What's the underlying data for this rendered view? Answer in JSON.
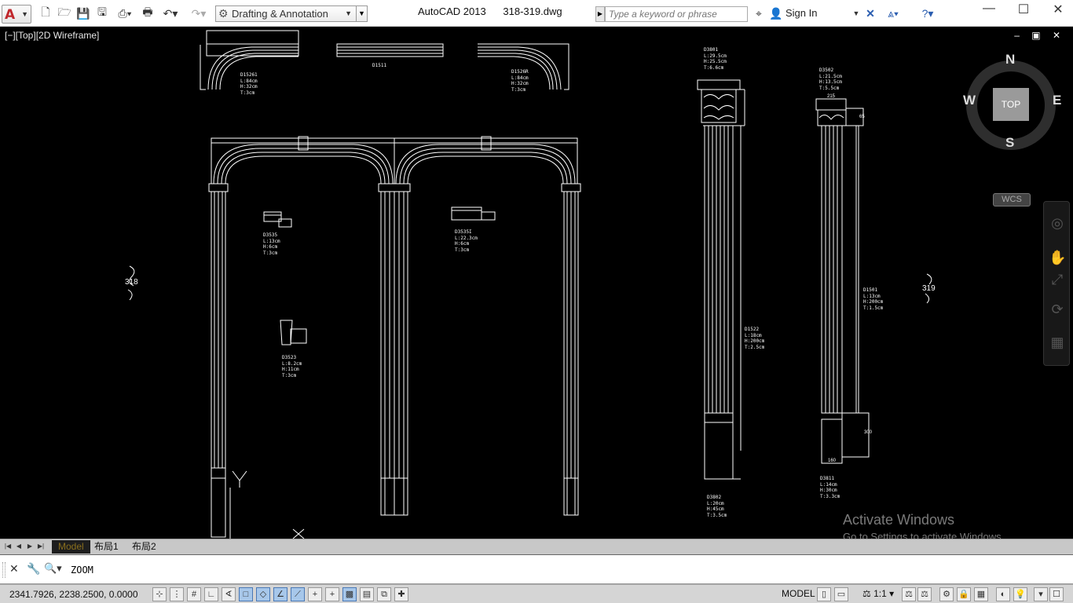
{
  "title_bar": {
    "workspace": "Drafting & Annotation",
    "app_name": "AutoCAD 2013",
    "file_name": "318-319.dwg",
    "search_placeholder": "Type a keyword or phrase",
    "sign_in": "Sign In"
  },
  "viewport": {
    "label": "[−][Top][2D Wireframe]",
    "controls": "– ▣ ✕"
  },
  "viewcube": {
    "north": "N",
    "south": "S",
    "east": "E",
    "west": "W",
    "top": "TOP",
    "ucs": "WCS"
  },
  "drawing": {
    "break_left": "318",
    "break_right": "319",
    "labels": {
      "d1": [
        "D15261",
        "L:84cm",
        "H:32cm",
        "T:3cm"
      ],
      "d2": [
        "D1511"
      ],
      "d3": [
        "D1526R",
        "L:84cm",
        "H:32cm",
        "T:3cm"
      ],
      "d4": [
        "D3535",
        "L:13cm",
        "H:6cm",
        "T:3cm"
      ],
      "d5": [
        "D3535I",
        "L:22.3cm",
        "H:6cm",
        "T:3cm"
      ],
      "d6": [
        "D3523",
        "L:8.2cm",
        "H:11cm",
        "T:3cm"
      ],
      "d7": [
        "D3801",
        "L:29.5cm",
        "H:25.5cm",
        "T:6.6cm"
      ],
      "d8": [
        "D1522",
        "L:18cm",
        "H:200cm",
        "T:2.5cm"
      ],
      "d9": [
        "D3802",
        "L:20cm",
        "H:45cm",
        "T:3.5cm"
      ],
      "d10": [
        "D3502",
        "L:21.5cm",
        "H:13.5cm",
        "T:5.5cm"
      ],
      "d11": [
        "D1501",
        "L:13cm",
        "H:200cm",
        "T:1.5cm"
      ],
      "d12": [
        "D3811",
        "L:14cm",
        "H:30cm",
        "T:3.3cm"
      ]
    },
    "dims": {
      "d_215": "215",
      "d_65": "65",
      "d_300": "300",
      "d_160": "160"
    }
  },
  "activate": {
    "title": "Activate Windows",
    "subtitle": "Go to Settings to activate Windows."
  },
  "layout_tabs": [
    "Model",
    "布局1",
    "布局2"
  ],
  "command": {
    "text": "ZOOM"
  },
  "status": {
    "coords": "2341.7926, 2238.2500, 0.0000",
    "model": "MODEL",
    "scale": "1:1"
  }
}
